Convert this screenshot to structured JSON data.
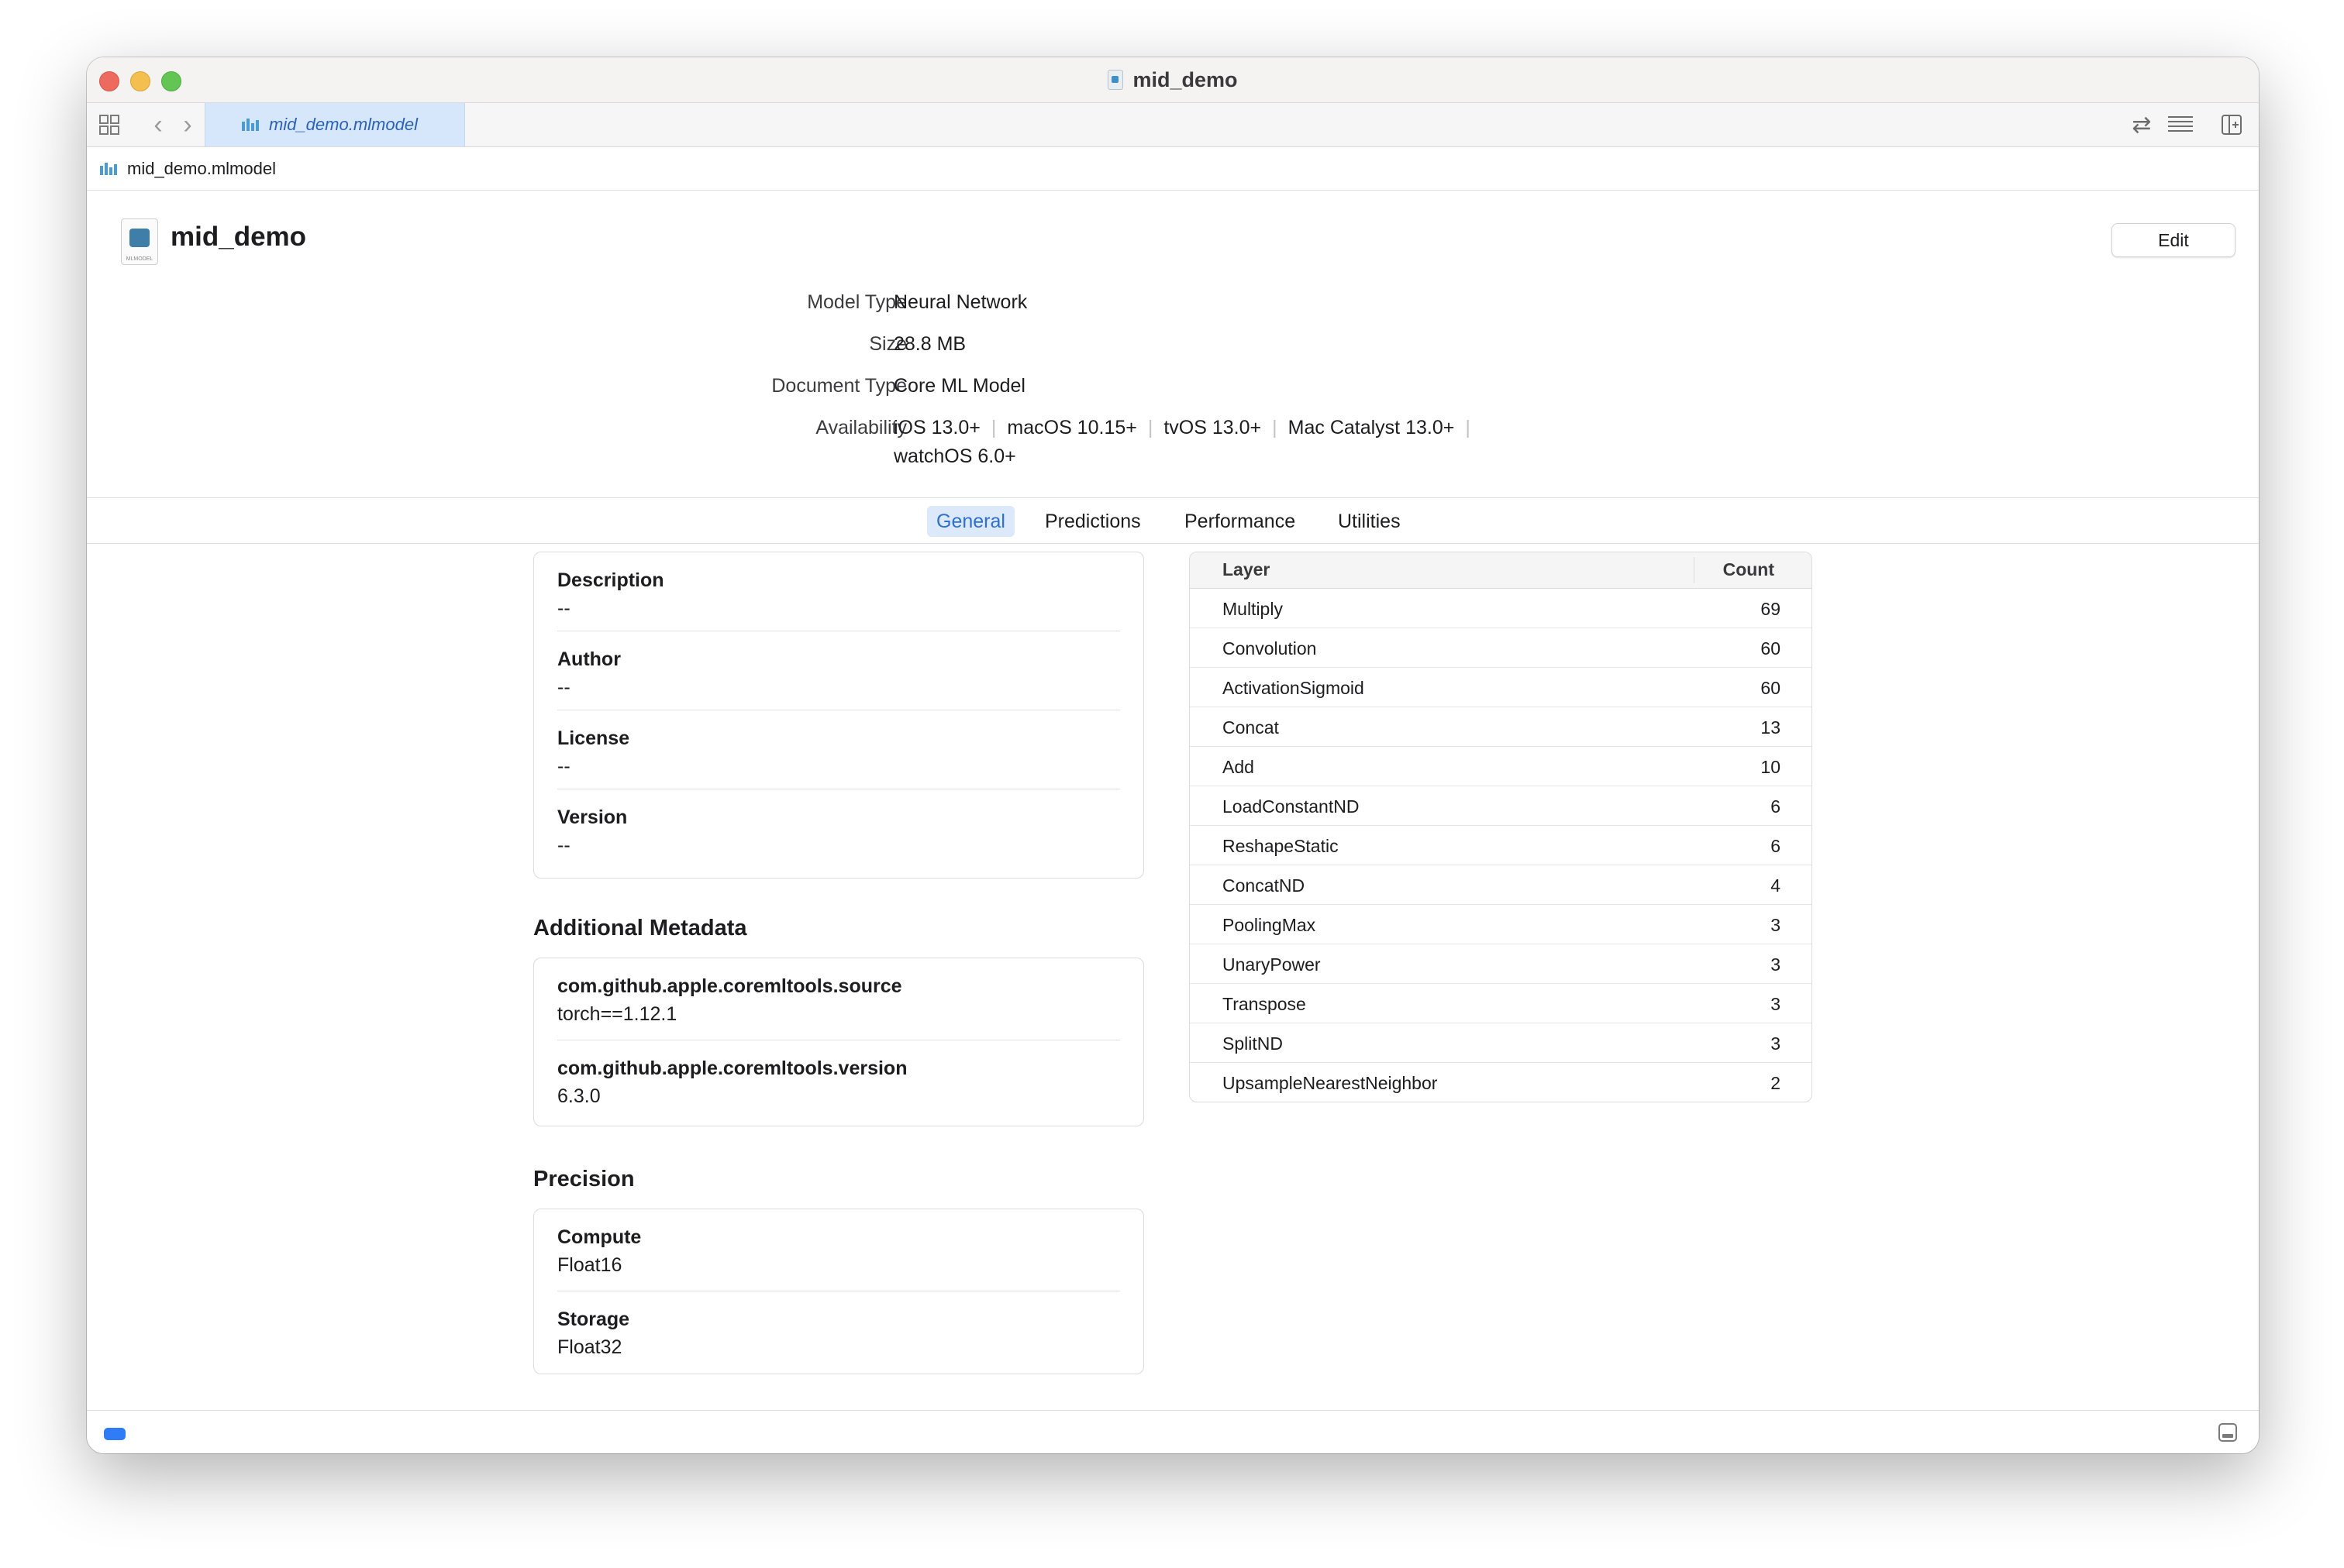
{
  "window": {
    "title": "mid_demo"
  },
  "tabbar": {
    "active_tab": "mid_demo.mlmodel"
  },
  "breadcrumb": {
    "file": "mid_demo.mlmodel"
  },
  "header": {
    "model_name": "mid_demo",
    "edit_label": "Edit",
    "icon_caption": "MLMODEL"
  },
  "meta": {
    "model_type_label": "Model Type",
    "model_type_value": "Neural Network",
    "size_label": "Size",
    "size_value": "28.8 MB",
    "doc_type_label": "Document Type",
    "doc_type_value": "Core ML Model",
    "availability_label": "Availability",
    "availability": [
      "iOS 13.0+",
      "macOS 10.15+",
      "tvOS 13.0+",
      "Mac Catalyst 13.0+",
      "watchOS 6.0+"
    ],
    "separator": "|"
  },
  "tabs": [
    {
      "label": "General",
      "active": true
    },
    {
      "label": "Predictions",
      "active": false
    },
    {
      "label": "Performance",
      "active": false
    },
    {
      "label": "Utilities",
      "active": false
    }
  ],
  "general": {
    "fields": [
      {
        "label": "Description",
        "value": "--"
      },
      {
        "label": "Author",
        "value": "--"
      },
      {
        "label": "License",
        "value": "--"
      },
      {
        "label": "Version",
        "value": "--"
      }
    ],
    "additional_metadata_title": "Additional Metadata",
    "additional_metadata": [
      {
        "label": "com.github.apple.coremltools.source",
        "value": "torch==1.12.1"
      },
      {
        "label": "com.github.apple.coremltools.version",
        "value": "6.3.0"
      }
    ],
    "precision_title": "Precision",
    "precision": [
      {
        "label": "Compute",
        "value": "Float16"
      },
      {
        "label": "Storage",
        "value": "Float32"
      }
    ]
  },
  "layers": {
    "col_layer": "Layer",
    "col_count": "Count",
    "rows": [
      {
        "name": "Multiply",
        "count": "69"
      },
      {
        "name": "Convolution",
        "count": "60"
      },
      {
        "name": "ActivationSigmoid",
        "count": "60"
      },
      {
        "name": "Concat",
        "count": "13"
      },
      {
        "name": "Add",
        "count": "10"
      },
      {
        "name": "LoadConstantND",
        "count": "6"
      },
      {
        "name": "ReshapeStatic",
        "count": "6"
      },
      {
        "name": "ConcatND",
        "count": "4"
      },
      {
        "name": "PoolingMax",
        "count": "3"
      },
      {
        "name": "UnaryPower",
        "count": "3"
      },
      {
        "name": "Transpose",
        "count": "3"
      },
      {
        "name": "SplitND",
        "count": "3"
      },
      {
        "name": "UpsampleNearestNeighbor",
        "count": "2"
      }
    ]
  },
  "icons": {
    "grid": "grid-icon",
    "back": "chevron-left-icon",
    "forward": "chevron-right-icon",
    "swap": "swap-arrows-icon",
    "lines": "align-lines-icon",
    "panel": "inspector-panel-icon",
    "bottom_left": "activity-indicator-icon",
    "bottom_right": "debug-area-icon"
  },
  "colors": {
    "accent": "#2e6fd1",
    "tab_selected_bg": "#d6e6fb",
    "close": "#ed6a5e",
    "minimize": "#f5bf4f",
    "zoom": "#62c554"
  }
}
